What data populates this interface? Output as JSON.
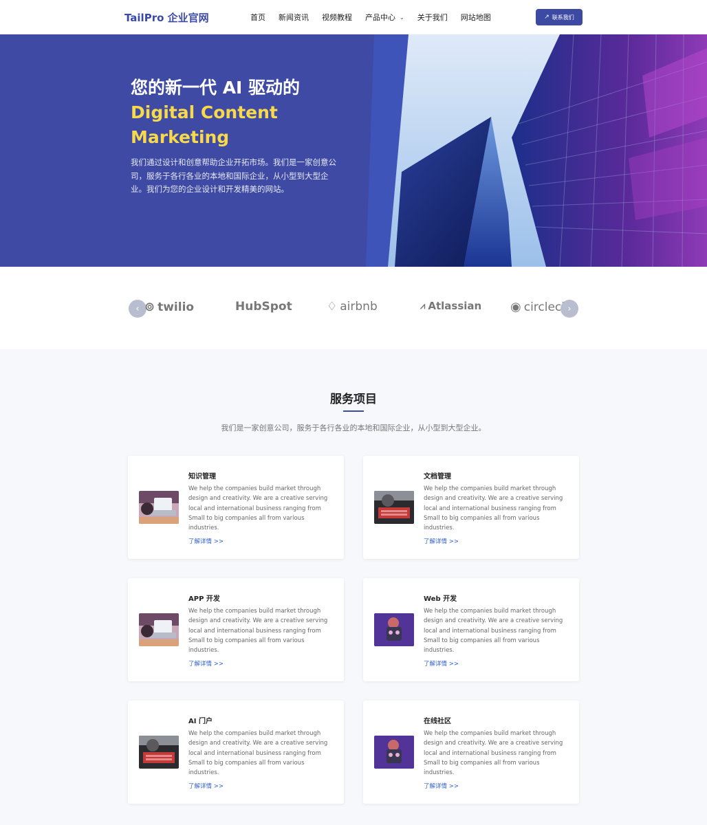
{
  "header": {
    "logo": "TailPro 企业官网",
    "nav": [
      "首页",
      "新闻资讯",
      "视频教程",
      "产品中心",
      "关于我们",
      "网站地图"
    ],
    "contact": "联系我们"
  },
  "hero": {
    "title_line1": "您的新一代 AI 驱动的",
    "title_highlight": "Digital Content Marketing",
    "description": "我们通过设计和创意帮助企业开拓市场。我们是一家创意公司，服务于各行各业的本地和国际企业，从小型到大型企业。我们为您的企业设计和开发精美的网站。"
  },
  "partners": [
    "twilio",
    "HubSpot",
    "airbnb",
    "Atlassian",
    "circleci"
  ],
  "services": {
    "title": "服务项目",
    "subtitle": "我们是一家创意公司，服务于各行各业的本地和国际企业，从小型到大型企业。",
    "description": "We help the companies build market through design and creativity. We are a creative serving local and international business ranging from Small to big companies all from various industries.",
    "link": "了解详情 >>",
    "items": [
      "知识管理",
      "文档管理",
      "APP 开发",
      "Web 开发",
      "AI 门户",
      "在线社区"
    ]
  }
}
